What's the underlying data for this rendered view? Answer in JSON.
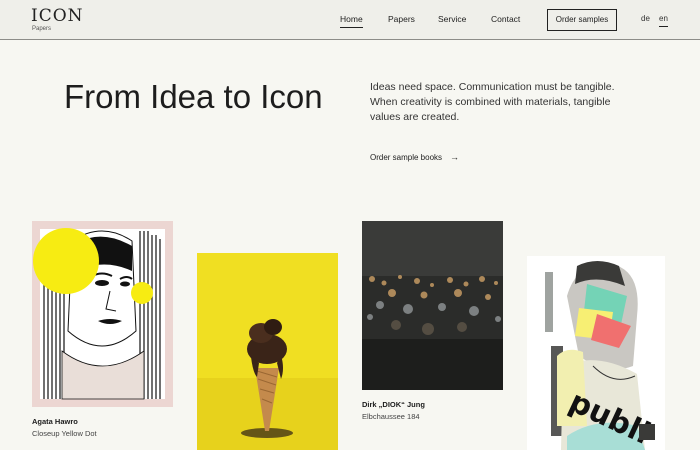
{
  "header": {
    "logo": "ICON",
    "logo_sub": "Papers",
    "nav": [
      "Home",
      "Papers",
      "Service",
      "Contact"
    ],
    "cta_button": "Order samples",
    "languages": [
      "de",
      "en"
    ]
  },
  "hero": {
    "title": "From Idea to Icon",
    "text": "Ideas need space. Communication must be tangible. When creativity is combined with materials, tangible values are created.",
    "link": "Order sample books",
    "link_icon": "arrow-right-icon"
  },
  "works": [
    {
      "author": "Agata Hawro",
      "title": "Closeup Yellow Dot",
      "image": "illustrated-portrait-with-yellow-dot"
    },
    {
      "author": "",
      "title": "",
      "image": "chocolate-ice-cream-cone-on-yellow"
    },
    {
      "author": "Dirk „DIOK“ Jung",
      "title": "Elbchaussee 184",
      "image": "blurred-night-city-lights"
    },
    {
      "author": "",
      "title": "",
      "image": "collage-portrait-publi"
    }
  ],
  "collage_text": "publi",
  "colors": {
    "background": "#f7f7f2",
    "header_bg": "#efefea",
    "accent_yellow": "#f7ec12"
  }
}
